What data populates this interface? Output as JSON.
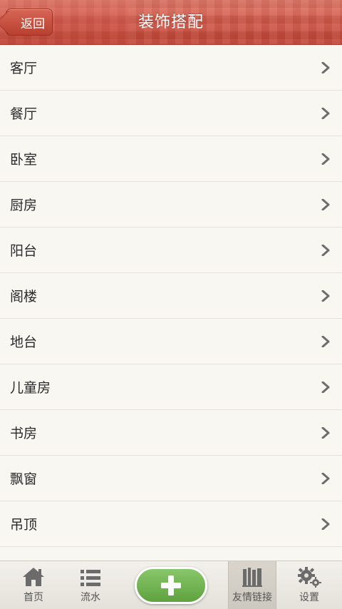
{
  "header": {
    "back_label": "返回",
    "title": "装饰搭配"
  },
  "list": {
    "items": [
      {
        "label": "客厅"
      },
      {
        "label": "餐厅"
      },
      {
        "label": "卧室"
      },
      {
        "label": "厨房"
      },
      {
        "label": "阳台"
      },
      {
        "label": "阁楼"
      },
      {
        "label": "地台"
      },
      {
        "label": "儿童房"
      },
      {
        "label": "书房"
      },
      {
        "label": "飘窗"
      },
      {
        "label": "吊顶"
      },
      {
        "label": ""
      }
    ]
  },
  "tabbar": {
    "home_label": "首页",
    "feed_label": "流水",
    "add_icon": "plus-icon",
    "links_label": "友情链接",
    "settings_label": "设置"
  },
  "colors": {
    "header_red": "#d15a4b",
    "add_green": "#6cb04b",
    "background": "#f7f4ee"
  }
}
